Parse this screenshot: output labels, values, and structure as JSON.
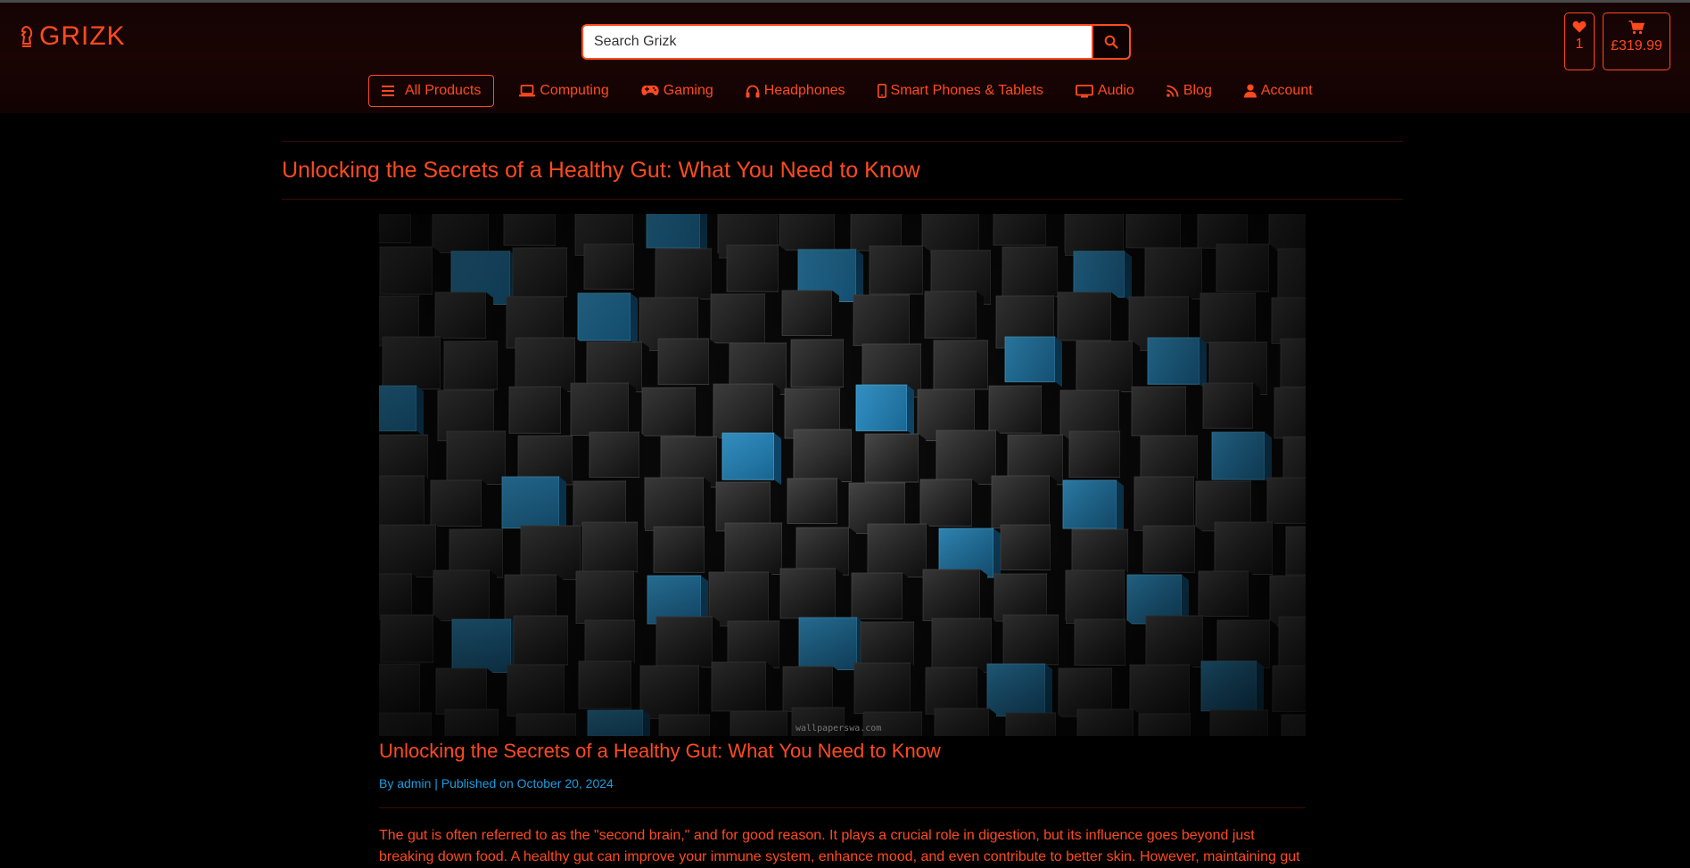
{
  "brand": {
    "name": "GRIZK"
  },
  "search": {
    "placeholder": "Search Grizk"
  },
  "wishlist": {
    "count": "1"
  },
  "cart": {
    "total": "£319.99"
  },
  "nav": {
    "all_products": "All Products",
    "items": [
      {
        "label": "Computing",
        "icon": "laptop-icon"
      },
      {
        "label": "Gaming",
        "icon": "gamepad-icon"
      },
      {
        "label": "Headphones",
        "icon": "headphones-icon"
      },
      {
        "label": "Smart Phones & Tablets",
        "icon": "phone-icon"
      },
      {
        "label": "Audio",
        "icon": "monitor-icon"
      },
      {
        "label": "Blog",
        "icon": "rss-icon"
      },
      {
        "label": "Account",
        "icon": "user-icon"
      }
    ]
  },
  "page": {
    "title": "Unlocking the Secrets of a Healthy Gut: What You Need to Know"
  },
  "post": {
    "title": "Unlocking the Secrets of a Healthy Gut: What You Need to Know",
    "author_prefix": "By",
    "author": "admin",
    "separator": "|",
    "published_prefix": "Published on",
    "date": "October 20, 2024",
    "image_watermark": "wallpaperswa.com",
    "body": "The gut is often referred to as the \"second brain,\" and for good reason. It plays a crucial role in digestion, but its influence goes beyond just breaking down food. A healthy gut can improve your immune system, enhance mood, and even contribute to better skin. However, maintaining gut"
  },
  "colors": {
    "accent": "#ff4a1f",
    "link_blue": "#1a9ee0",
    "background": "#000000",
    "header_bg": "#1a0404"
  }
}
